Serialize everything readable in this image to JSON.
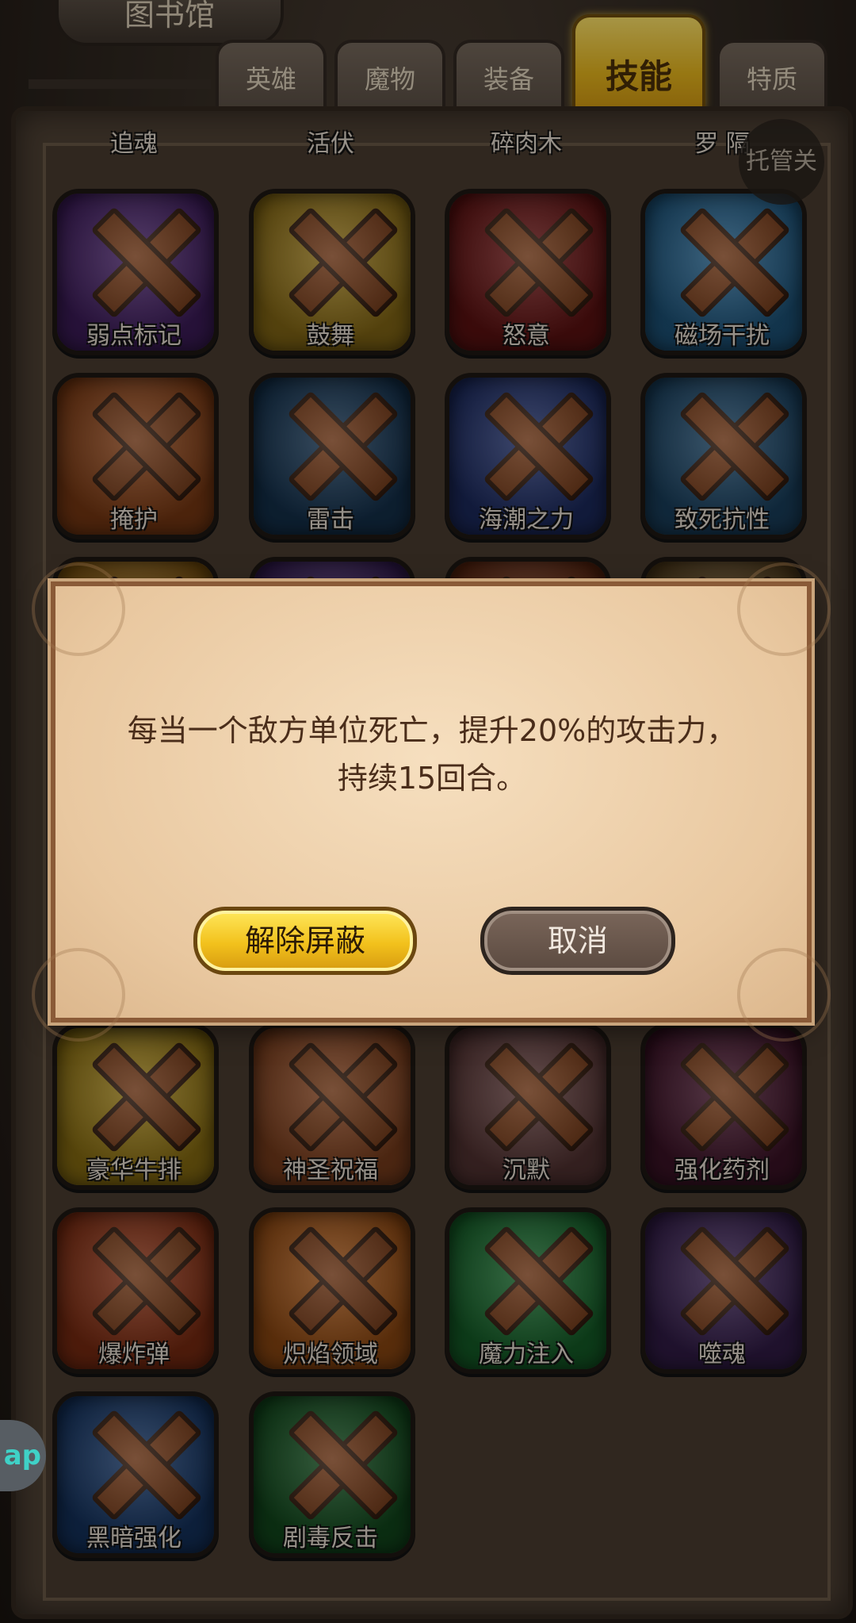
{
  "header": {
    "title": "图书馆",
    "tabs": [
      {
        "label": "英雄",
        "active": false
      },
      {
        "label": "魔物",
        "active": false
      },
      {
        "label": "装备",
        "active": false
      },
      {
        "label": "技能",
        "active": true
      },
      {
        "label": "特质",
        "active": false
      }
    ],
    "close_label": "托管关"
  },
  "grid": {
    "top_row_partial": [
      "追魂",
      "活伏",
      "碎肉木",
      "罗  隔"
    ],
    "rows": [
      [
        "弱点标记",
        "鼓舞",
        "怒意",
        "磁场干扰"
      ],
      [
        "掩护",
        "雷击",
        "海潮之力",
        "致死抗性"
      ],
      [
        "",
        "",
        "",
        ""
      ],
      [
        "豪华牛排",
        "神圣祝福",
        "沉默",
        "强化药剂"
      ],
      [
        "爆炸弹",
        "炽焰领域",
        "魔力注入",
        "噬魂"
      ],
      [
        "黑暗强化",
        "剧毒反击"
      ]
    ],
    "icon_colors": [
      [
        "#5b2a86",
        "#c49a1f",
        "#8a1a1a",
        "#2b7bb3"
      ],
      [
        "#b3541c",
        "#1e4870",
        "#2a3f8c",
        "#265e8a"
      ],
      [
        "#b77a16",
        "#4e2a7a",
        "#8a3a1a",
        "#7a5a2a"
      ],
      [
        "#caa21a",
        "#b25a2a",
        "#7a4b4a",
        "#5a1c3a"
      ],
      [
        "#b5401a",
        "#d06a1a",
        "#1e8a3a",
        "#4a2a6a"
      ],
      [
        "#1e4a8a",
        "#1a6a2a"
      ]
    ]
  },
  "dialog": {
    "text": "每当一个敌方单位死亡，提升20%的攻击力，持续15回合。",
    "confirm_label": "解除屏蔽",
    "cancel_label": "取消"
  },
  "side_tab": {
    "label": "ap"
  }
}
